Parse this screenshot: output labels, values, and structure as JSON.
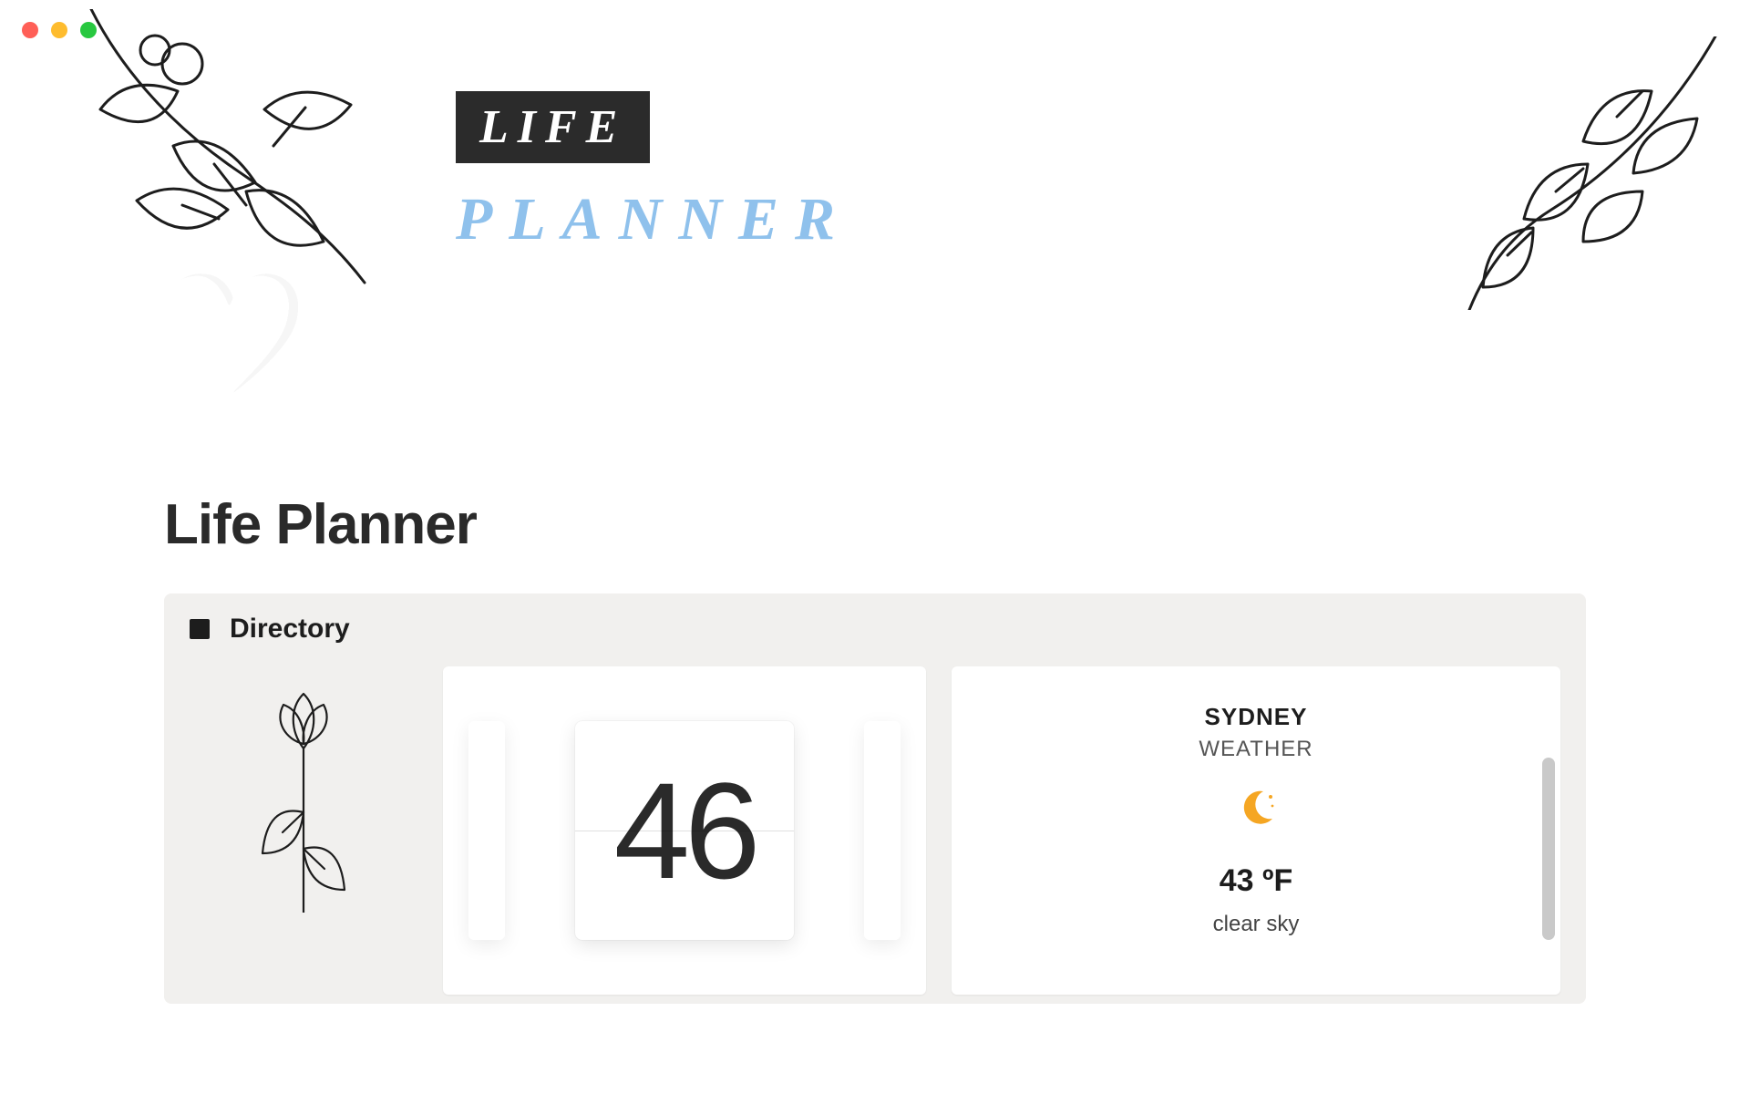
{
  "window": {
    "controls": [
      "close",
      "minimize",
      "zoom"
    ]
  },
  "cover": {
    "banner_top": "LIFE",
    "banner_bottom": "PLANNER",
    "page_icon": "🤍"
  },
  "page": {
    "title": "Life Planner"
  },
  "callout": {
    "icon": "black-square",
    "title": "Directory"
  },
  "clock": {
    "value": "46"
  },
  "weather": {
    "city": "SYDNEY",
    "label": "WEATHER",
    "icon": "moon",
    "temp": "43 ºF",
    "description": "clear sky"
  }
}
